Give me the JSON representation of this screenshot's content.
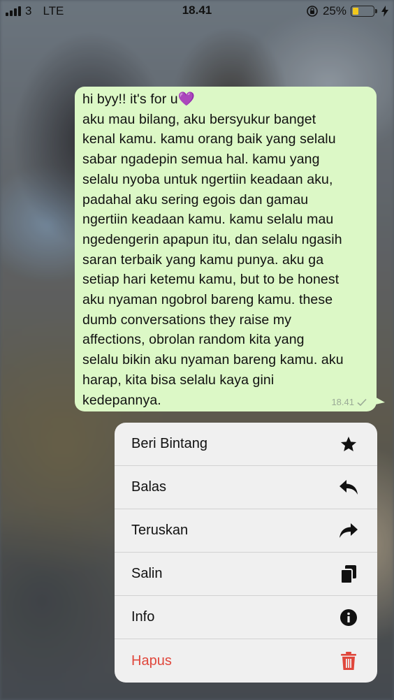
{
  "status_bar": {
    "carrier": "3",
    "network": "LTE",
    "time": "18.41",
    "battery_percent": "25%",
    "battery_level": 0.25,
    "icons": [
      "signal-icon",
      "rotation-lock-icon",
      "battery-icon",
      "charging-icon"
    ]
  },
  "message": {
    "lines": [
      "hi byy!! it's for u💜",
      "aku mau bilang, aku bersyukur banget",
      "kenal kamu. kamu orang baik yang selalu",
      "sabar ngadepin semua hal. kamu yang",
      "selalu nyoba untuk ngertiin keadaan aku,",
      "padahal aku sering egois dan gamau",
      "ngertiin keadaan kamu. kamu selalu mau",
      "ngedengerin apapun itu, dan selalu ngasih",
      "saran terbaik yang kamu punya. aku ga",
      "setiap hari ketemu kamu, but to be honest",
      "aku nyaman ngobrol bareng kamu. these",
      "dumb conversations they raise my",
      "affections, obrolan random kita yang",
      "selalu bikin aku nyaman bareng kamu. aku",
      "harap, kita bisa selalu kaya gini",
      "kedepannya."
    ],
    "time": "18.41",
    "status_icon": "check-icon",
    "bubble_color": "#dcf8c6"
  },
  "menu": {
    "items": [
      {
        "label": "Beri Bintang",
        "icon": "star-icon"
      },
      {
        "label": "Balas",
        "icon": "reply-icon"
      },
      {
        "label": "Teruskan",
        "icon": "forward-icon"
      },
      {
        "label": "Salin",
        "icon": "copy-icon"
      },
      {
        "label": "Info",
        "icon": "info-icon"
      },
      {
        "label": "Hapus",
        "icon": "trash-icon",
        "color": "#e0473c"
      }
    ]
  }
}
